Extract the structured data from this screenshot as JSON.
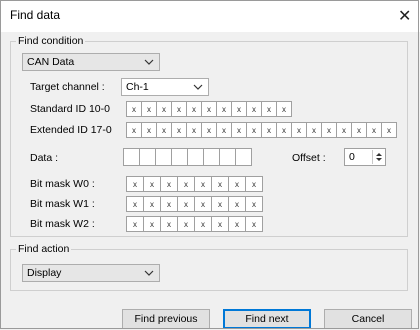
{
  "window": {
    "title": "Find data",
    "close_glyph": "✕"
  },
  "find_condition": {
    "legend": "Find condition",
    "data_type": {
      "value": "CAN Data"
    },
    "target_channel": {
      "label": "Target channel :",
      "value": "Ch-1"
    },
    "standard_id": {
      "label": "Standard ID 10-0",
      "bits": [
        "x",
        "x",
        "x",
        "x",
        "x",
        "x",
        "x",
        "x",
        "x",
        "x",
        "x"
      ]
    },
    "extended_id": {
      "label": "Extended ID 17-0",
      "bits": [
        "x",
        "x",
        "x",
        "x",
        "x",
        "x",
        "x",
        "x",
        "x",
        "x",
        "x",
        "x",
        "x",
        "x",
        "x",
        "x",
        "x",
        "x"
      ]
    },
    "data": {
      "label": "Data :",
      "bytes": [
        "",
        "",
        "",
        "",
        "",
        "",
        "",
        ""
      ]
    },
    "offset": {
      "label": "Offset :",
      "value": "0"
    },
    "bit_masks": [
      {
        "label": "Bit mask W0 :",
        "bits": [
          "x",
          "x",
          "x",
          "x",
          "x",
          "x",
          "x",
          "x"
        ]
      },
      {
        "label": "Bit mask W1 :",
        "bits": [
          "x",
          "x",
          "x",
          "x",
          "x",
          "x",
          "x",
          "x"
        ]
      },
      {
        "label": "Bit mask W2 :",
        "bits": [
          "x",
          "x",
          "x",
          "x",
          "x",
          "x",
          "x",
          "x"
        ]
      }
    ]
  },
  "find_action": {
    "legend": "Find action",
    "value": "Display"
  },
  "buttons": {
    "find_previous": "Find previous",
    "find_next": "Find next",
    "cancel": "Cancel"
  },
  "icons": {
    "chevron": "chevron-down-icon",
    "close": "close-icon",
    "spin": "spin-updown-icon"
  },
  "colors": {
    "accent": "#0078d7",
    "background": "#f0f0f0"
  }
}
